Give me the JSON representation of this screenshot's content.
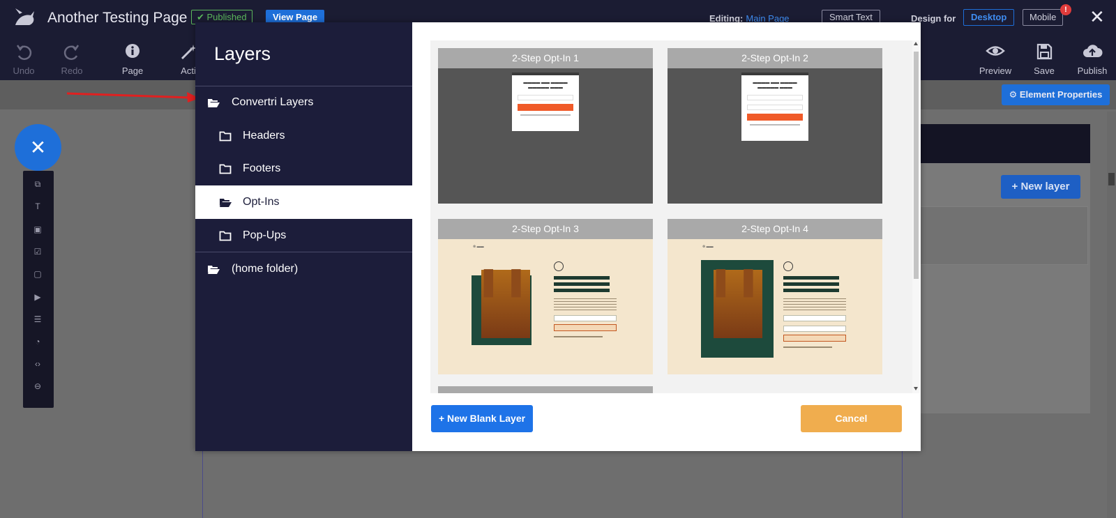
{
  "topbar": {
    "page_title": "Another Testing Page",
    "published_label": "Published",
    "view_page_label": "View Page",
    "editing_label": "Editing:",
    "editing_value": "Main Page",
    "smart_text_label": "Smart Text",
    "design_for_label": "Design for",
    "desktop_label": "Desktop",
    "mobile_label": "Mobile",
    "notification_badge": "!",
    "close_label": "✕",
    "tools_left": [
      {
        "label": "Undo",
        "icon": "undo-icon",
        "glyph": "↶"
      },
      {
        "label": "Redo",
        "icon": "redo-icon",
        "glyph": "↷"
      },
      {
        "label": "Page",
        "icon": "info-icon",
        "glyph": "ⓘ"
      },
      {
        "label": "Acti",
        "icon": "magic-wand-icon",
        "glyph": "✎"
      }
    ],
    "tools_right": [
      {
        "label": "Preview",
        "icon": "eye-icon"
      },
      {
        "label": "Save",
        "icon": "floppy-icon"
      },
      {
        "label": "Publish",
        "icon": "cloud-upload-icon"
      }
    ]
  },
  "canvas": {
    "element_properties_label": "⚙ Element Properties",
    "new_layer_label": "+ New layer"
  },
  "modal": {
    "title": "Layers",
    "folders": [
      {
        "label": "Convertri Layers",
        "open": true,
        "level": 0,
        "active": false
      },
      {
        "label": "Headers",
        "open": false,
        "level": 1,
        "active": false
      },
      {
        "label": "Footers",
        "open": false,
        "level": 1,
        "active": false
      },
      {
        "label": "Opt-Ins",
        "open": true,
        "level": 1,
        "active": true
      },
      {
        "label": "Pop-Ups",
        "open": false,
        "level": 1,
        "active": false
      },
      {
        "label": "(home folder)",
        "open": true,
        "level": 0,
        "active": false
      }
    ],
    "templates": [
      {
        "title": "2-Step Opt-In 1"
      },
      {
        "title": "2-Step Opt-In 2"
      },
      {
        "title": "2-Step Opt-In 3"
      },
      {
        "title": "2-Step Opt-In 4"
      }
    ],
    "new_blank_layer_label": "+ New Blank Layer",
    "cancel_label": "Cancel"
  },
  "colors": {
    "accent_blue": "#1e73e8",
    "cancel_orange": "#f0ad4e",
    "sidebar_navy": "#1c1d3a",
    "annotation_red": "#e02020"
  }
}
